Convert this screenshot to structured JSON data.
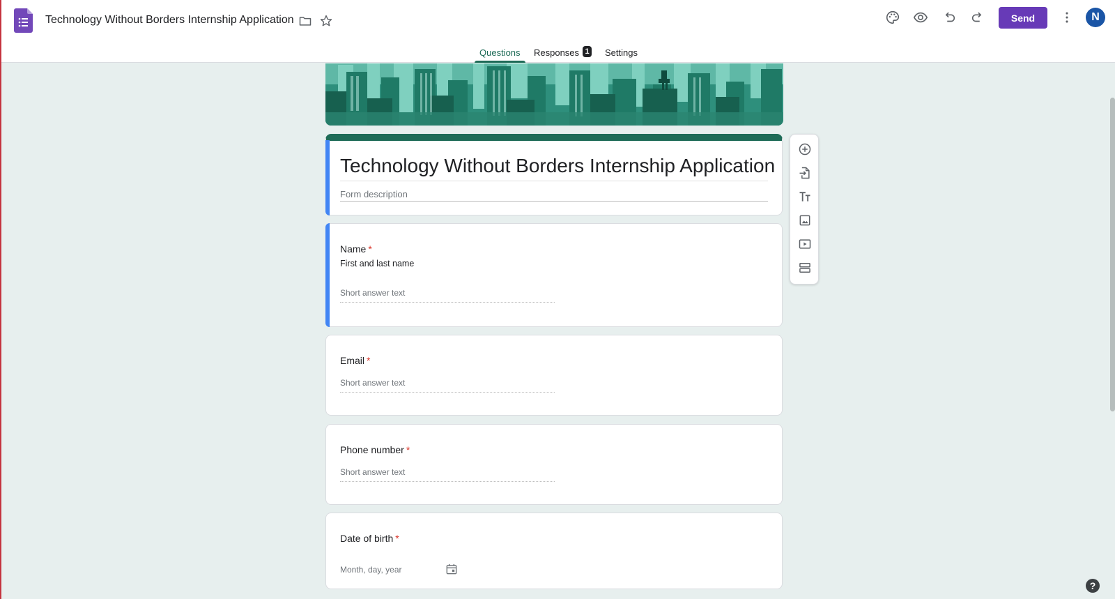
{
  "header": {
    "doc_title": "Technology Without Borders Internship Application",
    "send_label": "Send",
    "avatar_initial": "N",
    "icons": [
      "forms-logo-icon",
      "folder-icon",
      "star-icon",
      "palette-icon",
      "eye-icon",
      "undo-icon",
      "redo-icon",
      "more-vert-icon"
    ]
  },
  "tabs": [
    {
      "label": "Questions",
      "active": true
    },
    {
      "label": "Responses",
      "badge": "1"
    },
    {
      "label": "Settings"
    }
  ],
  "form": {
    "title": "Technology Without Borders Internship Application",
    "description_placeholder": "Form description"
  },
  "questions": [
    {
      "label": "Name",
      "required": "*",
      "help": "First and last name",
      "placeholder": "Short answer text"
    },
    {
      "label": "Email",
      "required": "*",
      "placeholder": "Short answer text"
    },
    {
      "label": "Phone number",
      "required": "*",
      "placeholder": "Short answer text"
    },
    {
      "label": "Date of birth",
      "required": "*",
      "placeholder": "Month, day, year"
    }
  ],
  "toolbar": {
    "icons": [
      "add-question-icon",
      "import-questions-icon",
      "add-title-icon",
      "add-image-icon",
      "add-video-icon",
      "add-section-icon"
    ]
  },
  "colors": {
    "accent": "#673ab7",
    "theme": "#1e6b57",
    "background": "#e7efee",
    "selected": "#4285f4",
    "required": "#d93025"
  },
  "help_label": "?"
}
